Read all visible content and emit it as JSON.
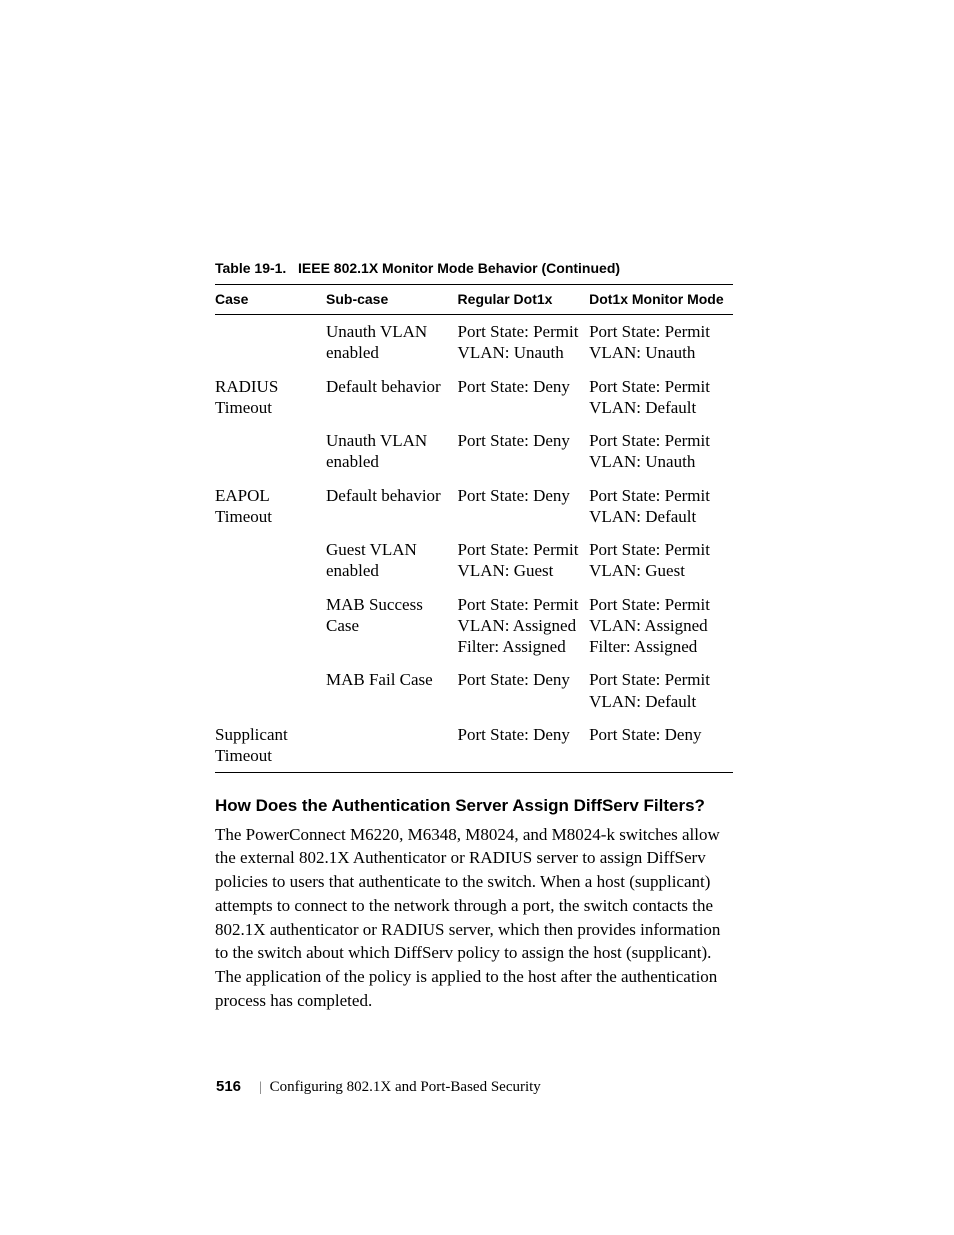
{
  "caption": {
    "label": "Table 19-1.",
    "title": "IEEE 802.1X Monitor Mode Behavior (Continued)"
  },
  "headers": {
    "c1": "Case",
    "c2": "Sub-case",
    "c3": "Regular Dot1x",
    "c4": "Dot1x Monitor Mode"
  },
  "rows": [
    {
      "case": "",
      "sub": "Unauth VLAN enabled",
      "reg": "Port State: Permit\nVLAN: Unauth",
      "mon": "Port State: Permit\nVLAN: Unauth"
    },
    {
      "case": "RADIUS Timeout",
      "sub": "Default behavior",
      "reg": "Port State: Deny",
      "mon": "Port State: Permit\nVLAN: Default"
    },
    {
      "case": "",
      "sub": "Unauth VLAN enabled",
      "reg": "Port State: Deny",
      "mon": "Port State: Permit\nVLAN: Unauth"
    },
    {
      "case": "EAPOL Timeout",
      "sub": "Default behavior",
      "reg": "Port State: Deny",
      "mon": "Port State: Permit\nVLAN: Default"
    },
    {
      "case": "",
      "sub": "Guest VLAN enabled",
      "reg": "Port State: Permit\nVLAN: Guest",
      "mon": "Port State: Permit\nVLAN: Guest"
    },
    {
      "case": "",
      "sub": "MAB Success Case",
      "reg": "Port State: Permit\nVLAN: Assigned\nFilter: Assigned",
      "mon": "Port State: Permit\nVLAN: Assigned\nFilter: Assigned"
    },
    {
      "case": "",
      "sub": "MAB Fail Case",
      "reg": "Port State: Deny",
      "mon": "Port State: Permit\nVLAN: Default"
    },
    {
      "case": "Supplicant Timeout",
      "sub": "",
      "reg": "Port State: Deny",
      "mon": "Port State: Deny"
    }
  ],
  "heading": "How Does the Authentication Server Assign DiffServ Filters?",
  "body": "The PowerConnect M6220, M6348, M8024, and M8024-k switches allow the external 802.1X Authenticator or RADIUS server to assign DiffServ policies to users that authenticate to the switch. When a host (supplicant) attempts to connect to the network through a port, the switch contacts the 802.1X authenticator or RADIUS server, which then provides information to the switch about which DiffServ policy to assign the host (supplicant). The application of the policy is applied to the host after the authentication process has completed.",
  "footer": {
    "page": "516",
    "chapter": "Configuring 802.1X and Port-Based Security"
  }
}
